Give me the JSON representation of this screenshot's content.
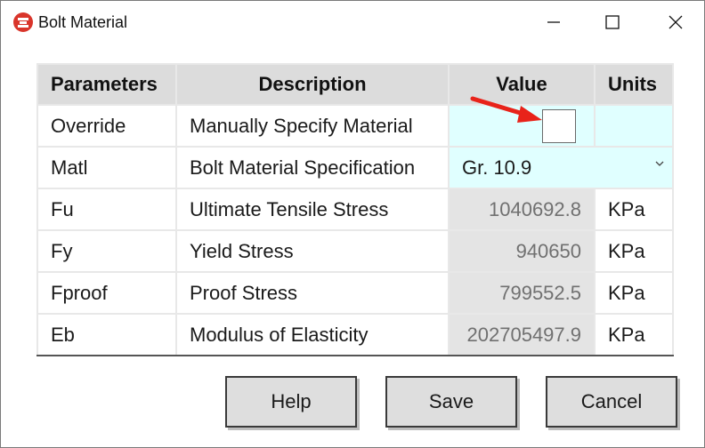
{
  "window": {
    "title": "Bolt Material",
    "accent_color": "#c0392b"
  },
  "table": {
    "headers": [
      "Parameters",
      "Description",
      "Value",
      "Units"
    ],
    "rows": [
      {
        "param": "Override",
        "desc": "Manually Specify Material",
        "value": "",
        "unit": "",
        "checked": false
      },
      {
        "param": "Matl",
        "desc": "Bolt Material Specification",
        "value": "Gr. 10.9",
        "unit": ""
      },
      {
        "param": "Fu",
        "desc": "Ultimate Tensile Stress",
        "value": "1040692.8",
        "unit": "KPa"
      },
      {
        "param": "Fy",
        "desc": "Yield Stress",
        "value": "940650",
        "unit": "KPa"
      },
      {
        "param": "Fproof",
        "desc": "Proof Stress",
        "value": "799552.5",
        "unit": "KPa"
      },
      {
        "param": "Eb",
        "desc": "Modulus of Elasticity",
        "value": "202705497.9",
        "unit": "KPa"
      }
    ]
  },
  "buttons": {
    "help": "Help",
    "save": "Save",
    "cancel": "Cancel"
  }
}
